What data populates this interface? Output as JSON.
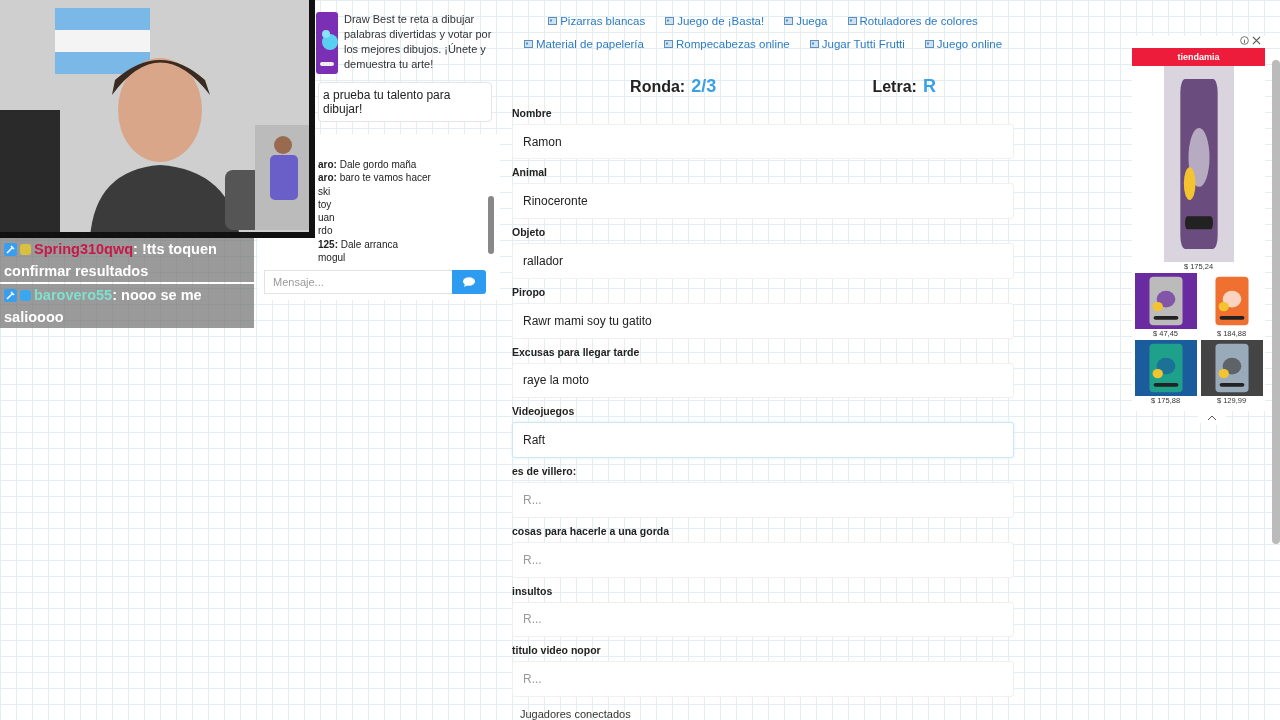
{
  "stream_overlay": {
    "chat": [
      {
        "user": "Spring310qwq",
        "color": "#c8184a",
        "text": ": !tts toquen confirmar resultados"
      },
      {
        "user": "barovero55",
        "color": "#7fe0d0",
        "text": ": nooo se me salioooo"
      }
    ]
  },
  "side": {
    "promo": {
      "text": "Draw Best te reta a dibujar palabras divertidas y votar por los mejores dibujos. ¡Únete y demuestra tu arte!",
      "cta": "a prueba tu talento para dibujar!"
    },
    "chat": {
      "messages": [
        {
          "user": "aro:",
          "text": "Dale gordo maña"
        },
        {
          "user": "aro:",
          "text": "baro te vamos hacer"
        },
        {
          "text": "ski"
        },
        {
          "text": "toy"
        },
        {
          "text": "uan"
        },
        {
          "text": "rdo"
        },
        {
          "user": "125:",
          "text": "Dale arranca"
        },
        {
          "text": "mogul"
        }
      ],
      "input": {
        "placeholder": "Mensaje..."
      }
    }
  },
  "links": [
    [
      "Pizarras blancas",
      "Juego de ¡Basta!",
      "Juega",
      "Rotuladores de colores"
    ],
    [
      "Material de papelería",
      "Rompecabezas online",
      "Jugar Tutti Frutti",
      "Juego online"
    ]
  ],
  "round": {
    "label": "Ronda:",
    "value": "2/3"
  },
  "letter": {
    "label": "Letra:",
    "value": "R"
  },
  "fields": [
    {
      "label": "Nombre",
      "value": "Ramon",
      "focused": false
    },
    {
      "label": "Animal",
      "value": "Rinoceronte",
      "focused": false
    },
    {
      "label": "Objeto",
      "value": "rallador",
      "focused": false
    },
    {
      "label": "Piropo",
      "value": "Rawr mami soy tu gatito",
      "focused": false
    },
    {
      "label": "Excusas para llegar tarde",
      "value": "raye la moto",
      "focused": false
    },
    {
      "label": "Videojuegos",
      "value": "Raft",
      "focused": true
    },
    {
      "label": "es de villero:",
      "placeholder": "R...",
      "focused": false
    },
    {
      "label": "cosas para hacerle a una gorda",
      "placeholder": "R...",
      "focused": false
    },
    {
      "label": "insultos",
      "placeholder": "R...",
      "focused": false
    },
    {
      "label": "titulo video nopor",
      "placeholder": "R...",
      "focused": false
    }
  ],
  "players_heading": "Jugadores conectados",
  "ad": {
    "brand": "tiendamia",
    "products": [
      {
        "price": "$ 175,24"
      },
      {
        "price": "$ 47,45"
      },
      {
        "price": "$ 184,88"
      },
      {
        "price": "$ 175,88"
      },
      {
        "price": "$ 129,99"
      }
    ]
  }
}
